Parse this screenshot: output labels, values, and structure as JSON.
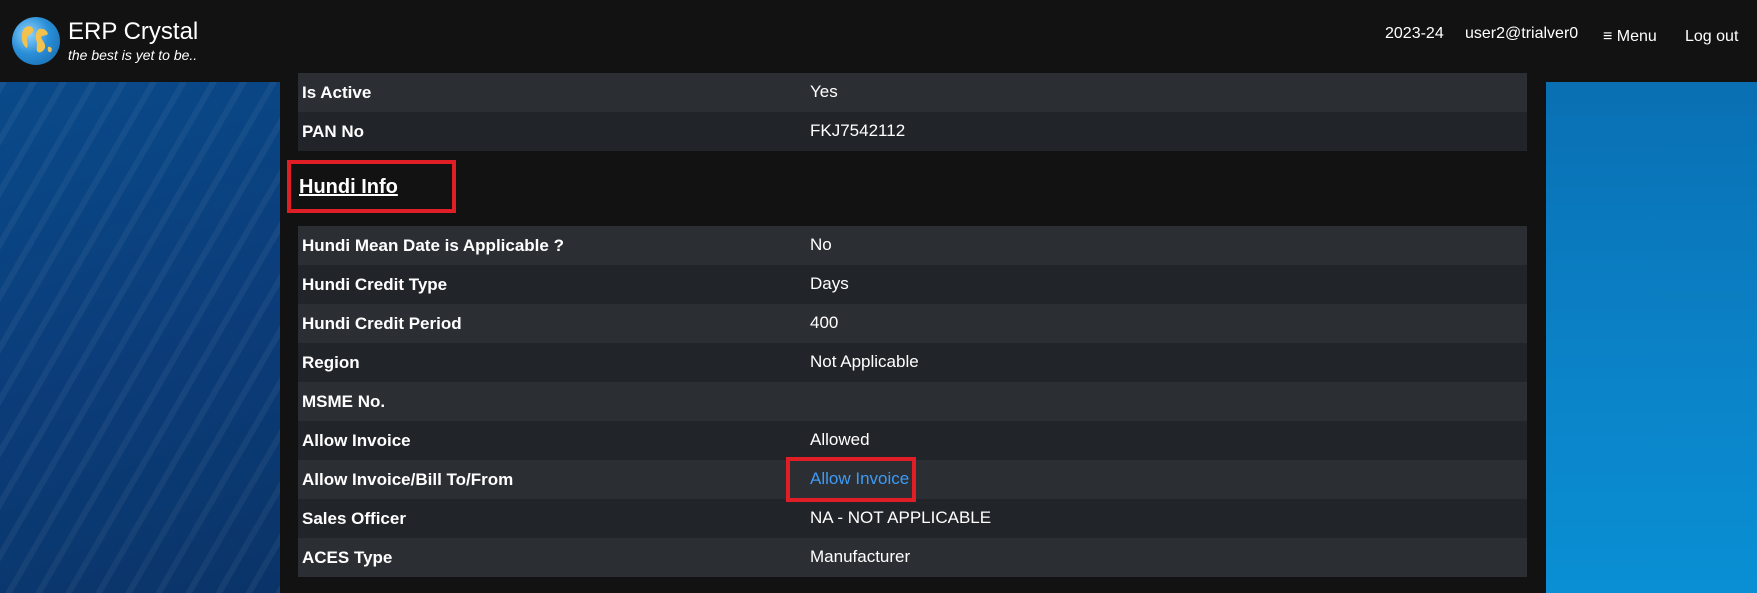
{
  "header": {
    "brand_name": "ERP Crystal",
    "brand_tagline": "the best is yet to be..",
    "fiscal_year": "2023-24",
    "user": "user2@trialver0",
    "menu_label": "≡ Menu",
    "logout_label": "Log out"
  },
  "top_rows": [
    {
      "label": "Is Active",
      "value": "Yes"
    },
    {
      "label": "PAN No",
      "value": "FKJ7542112"
    }
  ],
  "section_title": "Hundi Info",
  "hundi_rows": [
    {
      "label": "Hundi Mean Date is Applicable ?",
      "value": "No"
    },
    {
      "label": "Hundi Credit Type",
      "value": "Days"
    },
    {
      "label": "Hundi Credit Period",
      "value": "400"
    },
    {
      "label": "Region",
      "value": "Not Applicable"
    },
    {
      "label": "MSME No.",
      "value": ""
    },
    {
      "label": "Allow Invoice",
      "value": "Allowed"
    },
    {
      "label": "Allow Invoice/Bill To/From",
      "value": "Allow Invoice"
    },
    {
      "label": "Sales Officer",
      "value": "NA - NOT APPLICABLE"
    },
    {
      "label": "ACES Type",
      "value": "Manufacturer"
    }
  ],
  "colors": {
    "header_bg": "#121212",
    "row_odd": "#2b2e33",
    "row_even": "#212428",
    "link": "#3d9bf5",
    "highlight": "#e01e26"
  }
}
